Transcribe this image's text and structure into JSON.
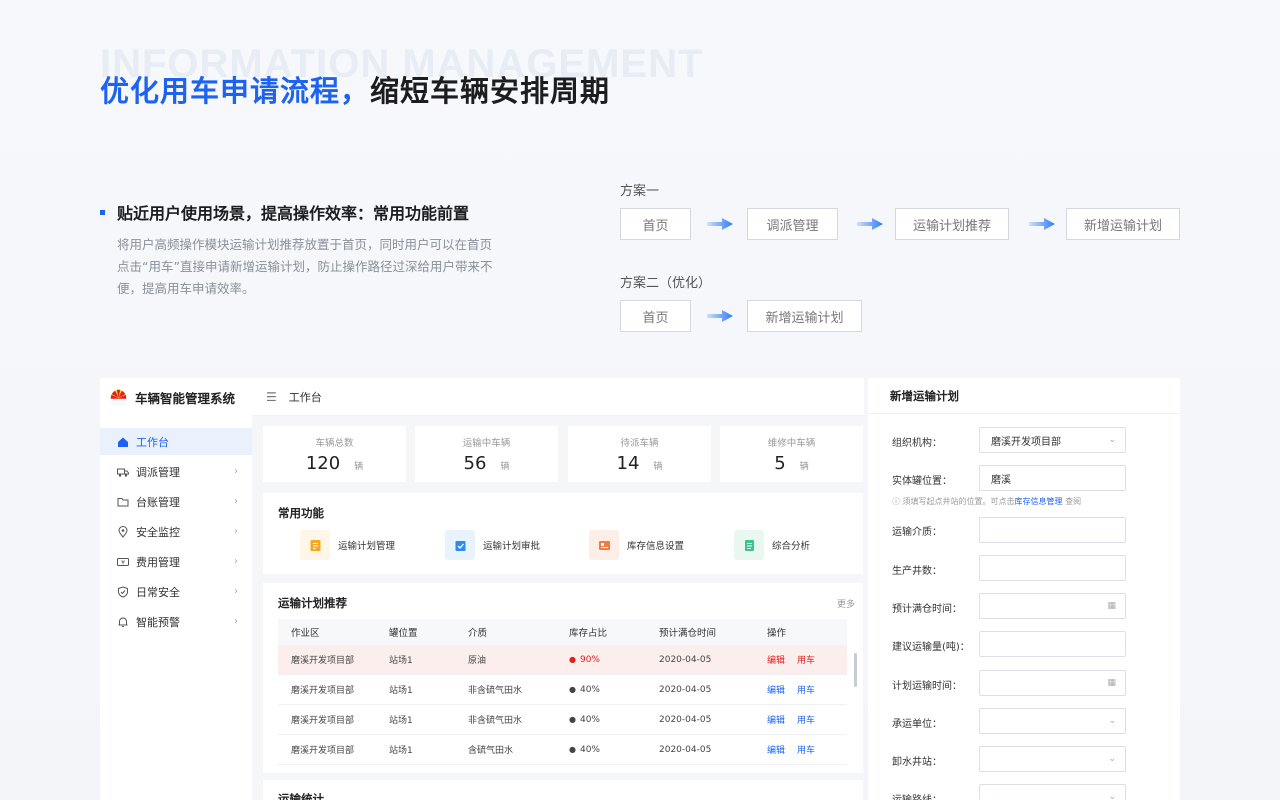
{
  "header": {
    "bg_word": "INFORMATION MANAGEMENT",
    "title_blue": "优化用车申请流程，",
    "title_dark": "缩短车辆安排周期"
  },
  "point": {
    "title": "贴近用户使用场景，提高操作效率：常用功能前置",
    "desc": "将用户高频操作模块运输计划推荐放置于首页，同时用户可以在首页点击“用车”直接申请新增运输计划，防止操作路径过深给用户带来不便，提高用车申请效率。"
  },
  "plans": [
    {
      "label": "方案一",
      "steps": [
        "首页",
        "调派管理",
        "运输计划推荐",
        "新增运输计划"
      ]
    },
    {
      "label": "方案二（优化）",
      "steps": [
        "首页",
        "新增运输计划"
      ]
    }
  ],
  "app": {
    "name": "车辆智能管理系统",
    "breadcrumb": "工作台",
    "nav": [
      {
        "label": "工作台",
        "icon": "home-icon",
        "active": true
      },
      {
        "label": "调派管理",
        "icon": "truck-icon"
      },
      {
        "label": "台账管理",
        "icon": "folder-icon"
      },
      {
        "label": "安全监控",
        "icon": "location-icon"
      },
      {
        "label": "费用管理",
        "icon": "money-icon"
      },
      {
        "label": "日常安全",
        "icon": "shield-icon"
      },
      {
        "label": "智能预警",
        "icon": "bell-icon"
      }
    ],
    "stats": [
      {
        "label": "车辆总数",
        "value": "120",
        "unit": "辆"
      },
      {
        "label": "运输中车辆",
        "value": "56",
        "unit": "辆"
      },
      {
        "label": "待派车辆",
        "value": "14",
        "unit": "辆"
      },
      {
        "label": "维修中车辆",
        "value": "5",
        "unit": "辆"
      }
    ],
    "functions_title": "常用功能",
    "functions": [
      {
        "label": "运输计划管理",
        "color": "#f5a623",
        "bg": "#fef6e7"
      },
      {
        "label": "运输计划审批",
        "color": "#2d8cf0",
        "bg": "#e8f3fe"
      },
      {
        "label": "库存信息设置",
        "color": "#f27b45",
        "bg": "#fdefe8"
      },
      {
        "label": "综合分析",
        "color": "#3cc48a",
        "bg": "#e8f8f0"
      }
    ],
    "table_title": "运输计划推荐",
    "more": "更多",
    "columns": [
      "作业区",
      "罐位置",
      "介质",
      "库存占比",
      "预计满仓时间",
      "操作"
    ],
    "rows": [
      {
        "area": "磨溪开发项目部",
        "pos": "站场1",
        "medium": "原油",
        "pct": "90%",
        "time": "2020-04-05",
        "edit": "编辑",
        "use": "用车",
        "alert": true
      },
      {
        "area": "磨溪开发项目部",
        "pos": "站场1",
        "medium": "非含硫气田水",
        "pct": "40%",
        "time": "2020-04-05",
        "edit": "编辑",
        "use": "用车"
      },
      {
        "area": "磨溪开发项目部",
        "pos": "站场1",
        "medium": "非含硫气田水",
        "pct": "40%",
        "time": "2020-04-05",
        "edit": "编辑",
        "use": "用车"
      },
      {
        "area": "磨溪开发项目部",
        "pos": "站场1",
        "medium": "含硫气田水",
        "pct": "40%",
        "time": "2020-04-05",
        "edit": "编辑",
        "use": "用车"
      }
    ],
    "bottom_title": "运输统计"
  },
  "form": {
    "title": "新增运输计划",
    "fields": [
      {
        "label": "组织机构：",
        "value": "磨溪开发项目部",
        "type": "select"
      },
      {
        "label": "实体罐位置：",
        "value": "磨溪",
        "type": "text"
      },
      {
        "label": "运输介质：",
        "value": "",
        "type": "text"
      },
      {
        "label": "生产井数：",
        "value": "",
        "type": "text"
      },
      {
        "label": "预计满仓时间：",
        "value": "",
        "type": "date"
      },
      {
        "label": "建议运输量(吨)：",
        "value": "",
        "type": "text"
      },
      {
        "label": "计划运输时间：",
        "value": "",
        "type": "date"
      },
      {
        "label": "承运单位：",
        "value": "",
        "type": "select"
      },
      {
        "label": "卸水井站：",
        "value": "",
        "type": "select"
      },
      {
        "label": "运输路线：",
        "value": "",
        "type": "select"
      }
    ],
    "hint_a": "ⓘ 须填写起点井站的位置。可点击",
    "hint_link": "库存信息管理",
    "hint_b": "查阅"
  }
}
